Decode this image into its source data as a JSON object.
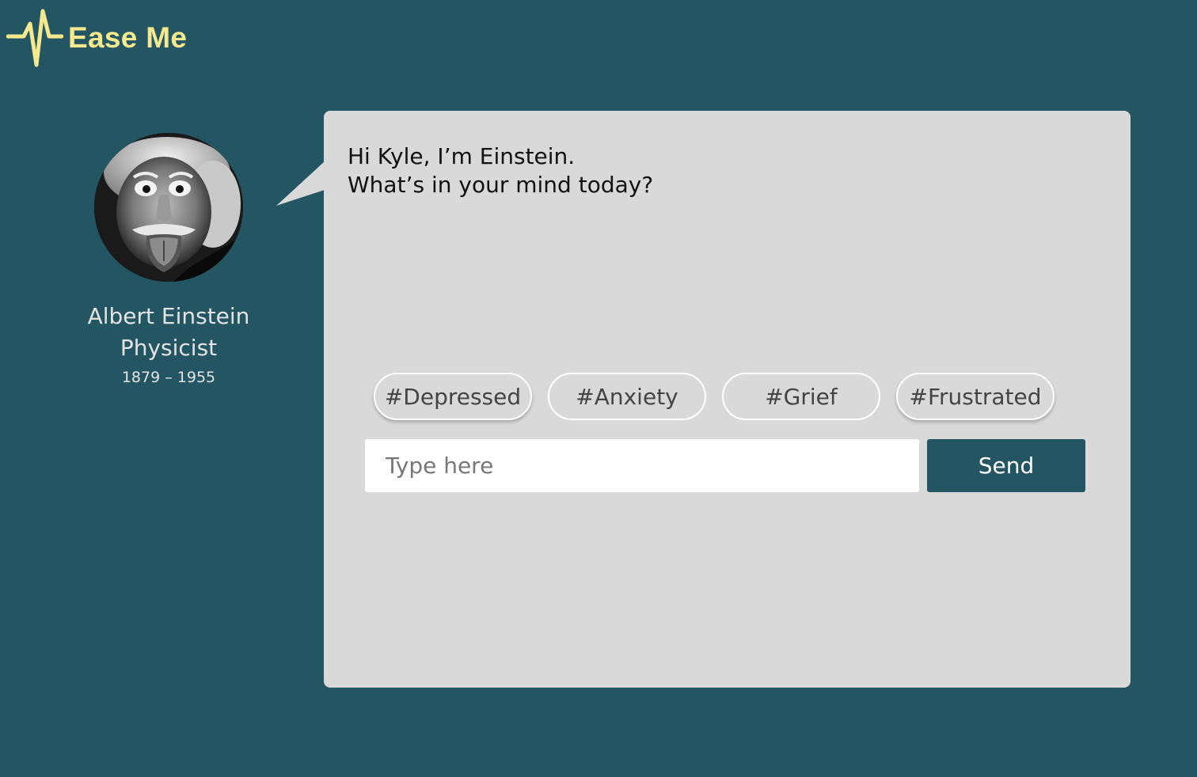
{
  "app": {
    "name": "Ease Me",
    "logo_icon": "heartbeat-pulse-icon",
    "logo_color": "#f4e98f",
    "background_color": "#245563"
  },
  "profile": {
    "avatar_icon": "einstein-portrait",
    "name": "Albert Einstein",
    "role": "Physicist",
    "years": "1879 – 1955"
  },
  "chat": {
    "panel_color": "#d9d9d9",
    "message_line1": "Hi Kyle, I’m Einstein.",
    "message_line2": "What’s in your mind today?",
    "tags": [
      {
        "label": "#Depressed"
      },
      {
        "label": "#Anxiety"
      },
      {
        "label": "#Grief"
      },
      {
        "label": "#Frustrated"
      }
    ],
    "input": {
      "placeholder": "Type here",
      "value": ""
    },
    "send_label": "Send",
    "send_color": "#245563"
  }
}
